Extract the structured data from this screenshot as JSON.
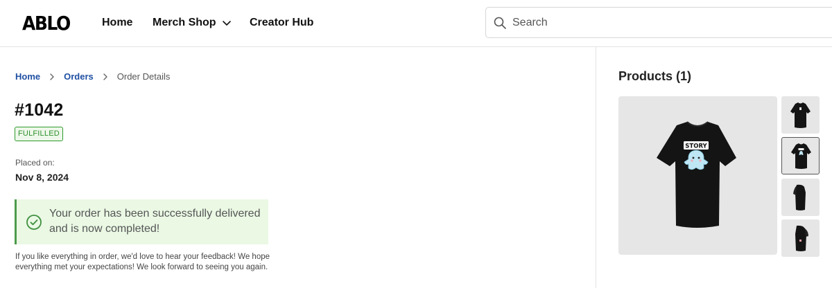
{
  "header": {
    "logo": "ABLO",
    "nav": {
      "home": "Home",
      "merch_shop": "Merch Shop",
      "creator_hub": "Creator Hub"
    },
    "search": {
      "placeholder": "Search",
      "value": ""
    }
  },
  "breadcrumb": {
    "home": "Home",
    "orders": "Orders",
    "current": "Order Details"
  },
  "order": {
    "number": "#1042",
    "status": "FULFILLED",
    "placed_label": "Placed on:",
    "placed_date": "Nov 8, 2024",
    "alert_message": "Your order has been successfully delivered and is now completed!",
    "feedback": "If you like everything in order, we'd love to hear your feedback! We hope everything met your expectations! We look forward to seeing you again."
  },
  "products": {
    "title": "Products (1)",
    "shirt_print_text": "STORY"
  },
  "colors": {
    "accent_link": "#1f4fa3",
    "success": "#2f9a2f",
    "success_bg": "#eaf8e4",
    "shirt": "#111111"
  }
}
